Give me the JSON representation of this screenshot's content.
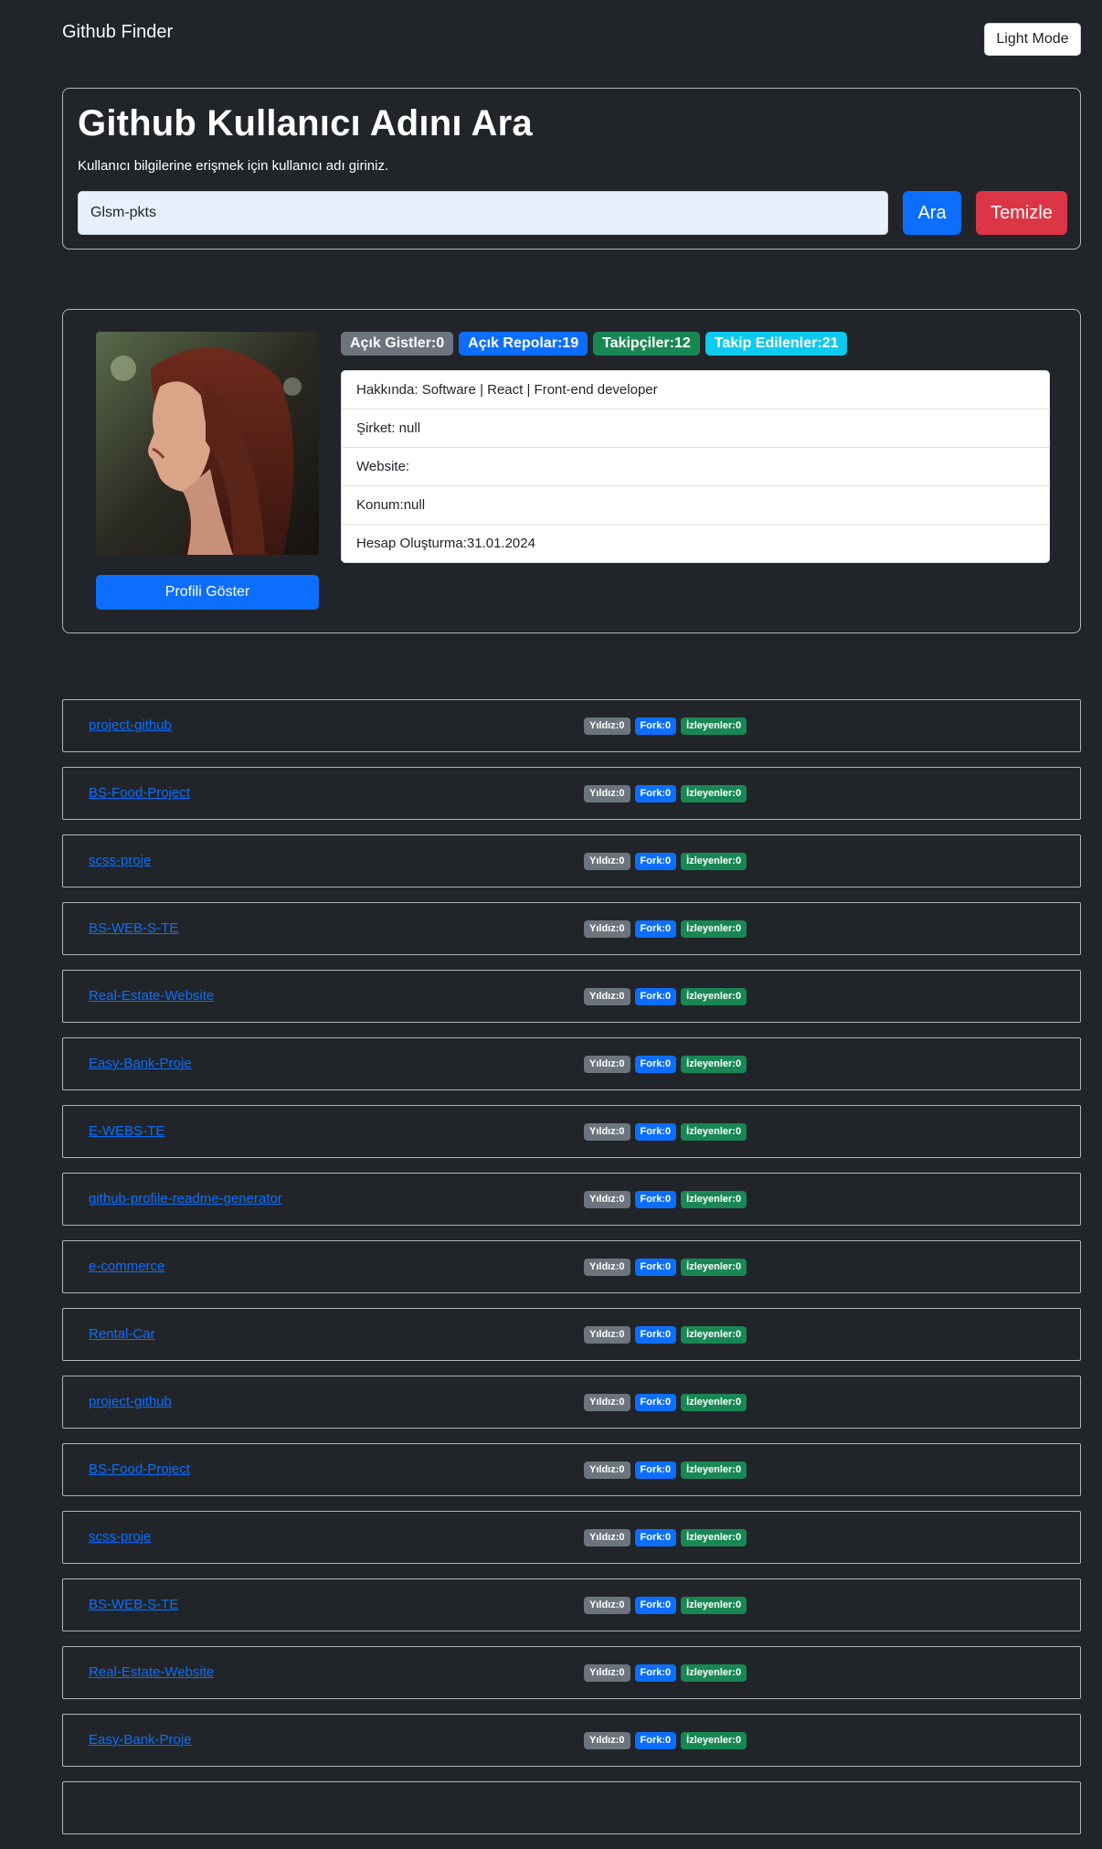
{
  "navbar": {
    "brand": "Github Finder",
    "mode_button": "Light Mode"
  },
  "search": {
    "title": "Github Kullanıcı Adını Ara",
    "subtitle": "Kullanıcı bilgilerine erişmek için kullanıcı adı giriniz.",
    "input_value": "Glsm-pkts",
    "search_button": "Ara",
    "clear_button": "Temizle"
  },
  "profile": {
    "show_profile_button": "Profili Göster",
    "badges": {
      "gists": "Açık Gistler:0",
      "repos": "Açık Repolar:19",
      "followers": "Takipçiler:12",
      "following": "Takip Edilenler:21"
    },
    "info": {
      "about": "Hakkında: Software | React | Front-end developer",
      "company": "Şirket: null",
      "website": "Website:",
      "location": "Konum:null",
      "created": "Hesap Oluşturma:31.01.2024"
    }
  },
  "repos": [
    {
      "name": "project-github",
      "stars": "Yıldız:0",
      "forks": "Fork:0",
      "watchers": "İzleyenler:0"
    },
    {
      "name": "BS-Food-Project",
      "stars": "Yıldız:0",
      "forks": "Fork:0",
      "watchers": "İzleyenler:0"
    },
    {
      "name": "scss-proje",
      "stars": "Yıldız:0",
      "forks": "Fork:0",
      "watchers": "İzleyenler:0"
    },
    {
      "name": "BS-WEB-S-TE",
      "stars": "Yıldız:0",
      "forks": "Fork:0",
      "watchers": "İzleyenler:0"
    },
    {
      "name": "Real-Estate-Website",
      "stars": "Yıldız:0",
      "forks": "Fork:0",
      "watchers": "İzleyenler:0"
    },
    {
      "name": "Easy-Bank-Proje",
      "stars": "Yıldız:0",
      "forks": "Fork:0",
      "watchers": "İzleyenler:0"
    },
    {
      "name": "E-WEBS-TE",
      "stars": "Yıldız:0",
      "forks": "Fork:0",
      "watchers": "İzleyenler:0"
    },
    {
      "name": "github-profile-readme-generator",
      "stars": "Yıldız:0",
      "forks": "Fork:0",
      "watchers": "İzleyenler:0"
    },
    {
      "name": "e-commerce",
      "stars": "Yıldız:0",
      "forks": "Fork:0",
      "watchers": "İzleyenler:0"
    },
    {
      "name": "Rental-Car",
      "stars": "Yıldız:0",
      "forks": "Fork:0",
      "watchers": "İzleyenler:0"
    },
    {
      "name": "project-github",
      "stars": "Yıldız:0",
      "forks": "Fork:0",
      "watchers": "İzleyenler:0"
    },
    {
      "name": "BS-Food-Project",
      "stars": "Yıldız:0",
      "forks": "Fork:0",
      "watchers": "İzleyenler:0"
    },
    {
      "name": "scss-proje",
      "stars": "Yıldız:0",
      "forks": "Fork:0",
      "watchers": "İzleyenler:0"
    },
    {
      "name": "BS-WEB-S-TE",
      "stars": "Yıldız:0",
      "forks": "Fork:0",
      "watchers": "İzleyenler:0"
    },
    {
      "name": "Real-Estate-Website",
      "stars": "Yıldız:0",
      "forks": "Fork:0",
      "watchers": "İzleyenler:0"
    },
    {
      "name": "Easy-Bank-Proje",
      "stars": "Yıldız:0",
      "forks": "Fork:0",
      "watchers": "İzleyenler:0"
    },
    {
      "name": "",
      "stars": "",
      "forks": "",
      "watchers": ""
    }
  ],
  "colors": {
    "background": "#212529",
    "primary": "#0d6efd",
    "danger": "#dc3545",
    "secondary": "#6c757d",
    "success": "#198754",
    "info": "#0dcaf0"
  }
}
